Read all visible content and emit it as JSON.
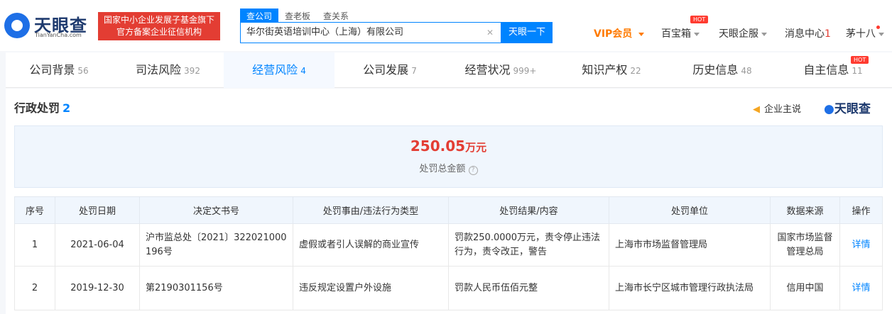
{
  "brand": {
    "name": "天眼查",
    "domain": "TianYanCha.com"
  },
  "badge": {
    "line1": "国家中小企业发展子基金旗下",
    "line2": "官方备案企业征信机构"
  },
  "search_tabs": [
    "查公司",
    "查老板",
    "查关系"
  ],
  "search": {
    "value": "华尔街英语培训中心（上海）有限公司",
    "button": "天眼一下"
  },
  "nav": {
    "vip": "VIP会员",
    "box": "百宝箱",
    "hot": "HOT",
    "enterprise": "天眼企服",
    "msg": "消息中心",
    "msg_count": "1",
    "user": "茅十八"
  },
  "tabs": [
    {
      "label": "公司背景",
      "count": "56"
    },
    {
      "label": "司法风险",
      "count": "392"
    },
    {
      "label": "经营风险",
      "count": "4"
    },
    {
      "label": "公司发展",
      "count": "7"
    },
    {
      "label": "经营状况",
      "count": "999+"
    },
    {
      "label": "知识产权",
      "count": "22"
    },
    {
      "label": "历史信息",
      "count": "48"
    },
    {
      "label": "自主信息",
      "count": "11"
    }
  ],
  "section": {
    "title": "行政处罚",
    "count": "2",
    "say": "企业主说",
    "logo": "天眼查"
  },
  "summary": {
    "amount": "250.05",
    "unit": "万元",
    "label": "处罚总金额"
  },
  "table": {
    "headers": [
      "序号",
      "处罚日期",
      "决定文书号",
      "处罚事由/违法行为类型",
      "处罚结果/内容",
      "处罚单位",
      "数据来源",
      "操作"
    ],
    "rows": [
      [
        "1",
        "2021-06-04",
        "沪市监总处〔2021〕322021000196号",
        "虚假或者引人误解的商业宣传",
        "罚款250.0000万元，责令停止违法行为，责令改正，警告",
        "上海市市场监督管理局",
        "国家市场监督管理总局",
        "详情"
      ],
      [
        "2",
        "2019-12-30",
        "第2190301156号",
        "违反规定设置户外设施",
        "罚款人民币伍佰元整",
        "上海市长宁区城市管理行政执法局",
        "信用中国",
        "详情"
      ]
    ]
  }
}
